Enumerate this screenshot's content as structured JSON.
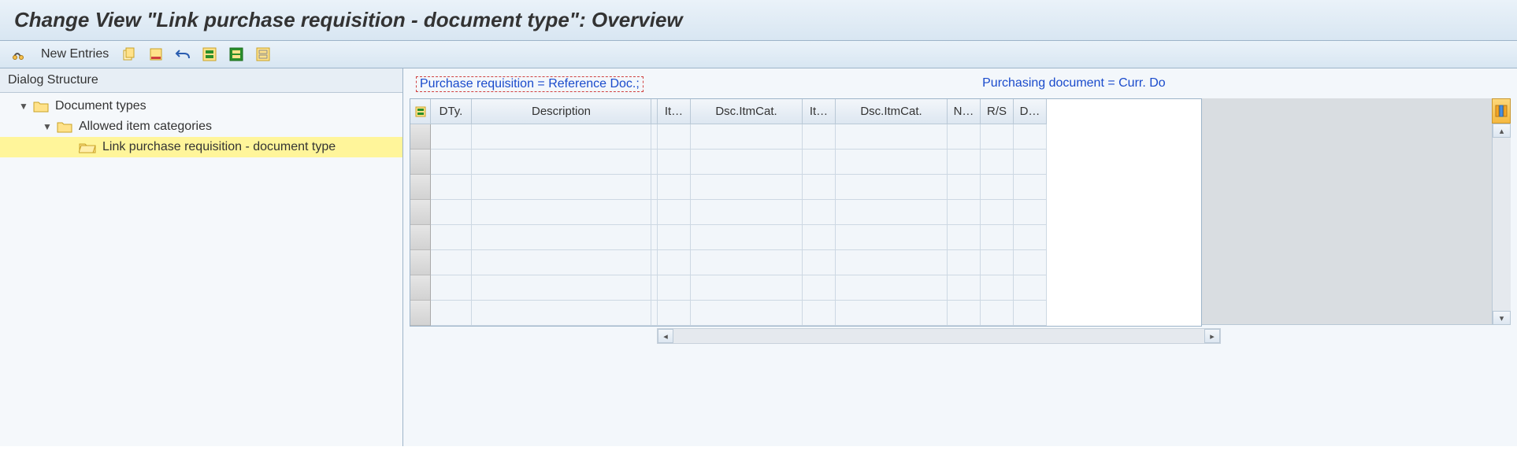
{
  "title": "Change View \"Link purchase requisition - document type\": Overview",
  "toolbar": {
    "new_entries": "New Entries"
  },
  "sidebar": {
    "header": "Dialog Structure",
    "node1": "Document types",
    "node2": "Allowed item categories",
    "node3": "Link purchase requisition - document type"
  },
  "content": {
    "left_label": "Purchase requisition = Reference Doc.;",
    "right_label": "Purchasing document = Curr. Do",
    "cols": {
      "c1": "DTy.",
      "c2": "Description",
      "c3": "It…",
      "c4": "Dsc.ItmCat.",
      "c5": "It…",
      "c6": "Dsc.ItmCat.",
      "c7": "N…",
      "c8": "R/S",
      "c9": "D…"
    }
  }
}
